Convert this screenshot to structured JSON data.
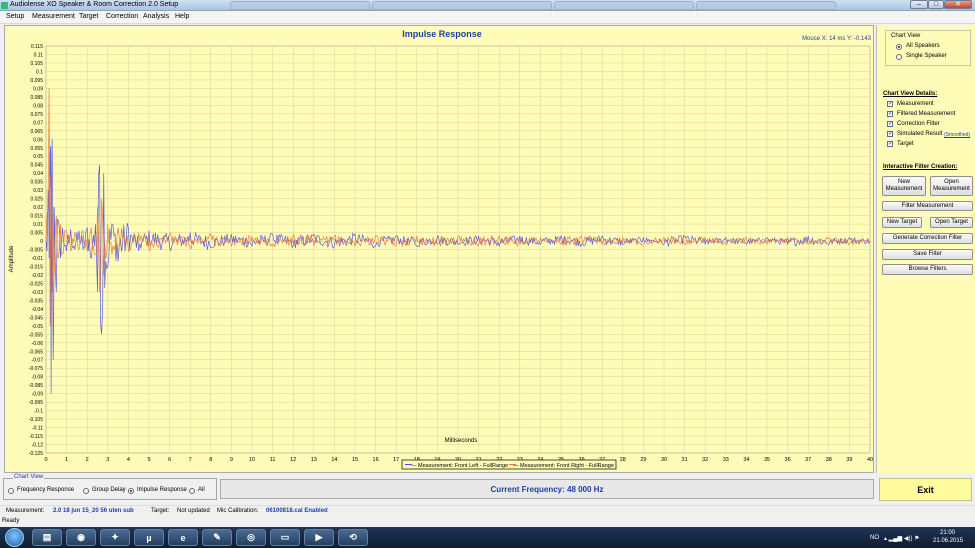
{
  "window": {
    "title": "Audiolense XO Speaker & Room Correction 2.0 Setup",
    "min_label": "–",
    "max_label": "□",
    "close_label": "✕"
  },
  "menu": [
    "Setup",
    "Measurement",
    "Target",
    "Correction",
    "Analysis",
    "Help"
  ],
  "chart": {
    "title": "Impulse Response",
    "mouse_readout": "Mouse X: 14 ms   Y: -0.143",
    "ylabel": "Amplitude",
    "xlabel": "Milliseconds",
    "legend": [
      "— Measurement: Front Left - FullRange",
      "— Measurement: Front Right - FullRange"
    ],
    "colors": {
      "left": "#4a4ae6",
      "right": "#e8703a",
      "grid": "#d8d29a",
      "axis": "#000000",
      "title": "#1f3fa5",
      "background": "#fffcb8"
    }
  },
  "chart_data": {
    "type": "line",
    "title": "Impulse Response",
    "xlabel": "Milliseconds",
    "ylabel": "Amplitude",
    "xlim": [
      0,
      40
    ],
    "ylim": [
      -0.125,
      0.115
    ],
    "x_ticks": [
      "0",
      "1",
      "2",
      "3",
      "4",
      "5",
      "6",
      "7",
      "8",
      "9",
      "10",
      "11",
      "12",
      "13",
      "14",
      "15",
      "16",
      "17",
      "18",
      "19",
      "20",
      "21",
      "22",
      "23",
      "24",
      "25",
      "26",
      "27",
      "28",
      "29",
      "30",
      "31",
      "32",
      "33",
      "34",
      "35",
      "36",
      "37",
      "38",
      "39",
      "40"
    ],
    "y_ticks": [
      "0.115",
      "0.11",
      "0.105",
      "0.1",
      "0.095",
      "0.09",
      "0.085",
      "0.08",
      "0.075",
      "0.07",
      "0.065",
      "0.06",
      "0.055",
      "0.05",
      "0.045",
      "0.04",
      "0.035",
      "0.03",
      "0.025",
      "0.02",
      "0.015",
      "0.01",
      "0.005",
      "0",
      "-0.005",
      "-0.01",
      "-0.015",
      "-0.02",
      "-0.025",
      "-0.03",
      "-0.035",
      "-0.04",
      "-0.045",
      "-0.05",
      "-0.055",
      "-0.06",
      "-0.065",
      "-0.07",
      "-0.075",
      "-0.08",
      "-0.085",
      "-0.09",
      "-0.095",
      "-0.1",
      "-0.105",
      "-0.11",
      "-0.115",
      "-0.12",
      "-0.125"
    ],
    "grid": true,
    "legend_position": "bottom-center",
    "series": [
      {
        "name": "Measurement: Front Left - FullRange",
        "x": [
          0,
          0.1,
          0.15,
          0.2,
          0.25,
          0.3,
          0.35,
          0.4,
          0.5,
          0.6,
          0.7,
          0.8,
          1.0,
          1.2,
          1.4,
          1.6,
          1.8,
          2.0,
          2.2,
          2.4,
          2.5,
          2.6,
          2.7,
          2.8,
          3.0,
          3.2,
          3.5,
          4.0,
          4.5,
          5.0,
          6,
          7,
          8,
          9,
          10,
          11,
          12,
          13,
          14,
          15,
          16,
          17,
          18,
          19,
          20,
          21,
          22,
          23,
          24,
          25,
          26,
          27,
          28,
          29,
          30,
          31,
          32,
          33,
          34,
          35,
          36,
          37,
          38,
          39,
          40
        ],
        "y": [
          0,
          0.03,
          -0.01,
          0.05,
          -0.09,
          0.06,
          -0.07,
          0.02,
          -0.03,
          0.012,
          -0.01,
          0.008,
          -0.006,
          0.007,
          -0.005,
          0.006,
          -0.005,
          0.008,
          -0.01,
          0.01,
          -0.03,
          0.045,
          -0.055,
          0.04,
          -0.015,
          0.01,
          -0.012,
          0.008,
          -0.006,
          0.006,
          -0.004,
          0.005,
          -0.004,
          0.004,
          -0.003,
          0.004,
          -0.003,
          0.004,
          -0.003,
          0.004,
          -0.003,
          0.003,
          -0.003,
          0.003,
          -0.002,
          0.003,
          -0.003,
          0.003,
          -0.002,
          0.003,
          -0.002,
          0.003,
          -0.002,
          0.002,
          -0.002,
          0.003,
          -0.002,
          0.002,
          -0.002,
          0.002,
          -0.002,
          0.003,
          -0.002,
          0.002,
          0
        ]
      },
      {
        "name": "Measurement: Front Right - FullRange",
        "x": [
          0,
          0.1,
          0.15,
          0.2,
          0.25,
          0.3,
          0.35,
          0.4,
          0.5,
          0.6,
          0.7,
          0.8,
          1.0,
          1.2,
          1.4,
          1.6,
          1.8,
          2.0,
          2.2,
          2.4,
          2.5,
          2.6,
          2.7,
          2.8,
          3.0,
          3.2,
          3.5,
          4.0,
          4.5,
          5.0,
          6,
          7,
          8,
          9,
          10,
          11,
          12,
          13,
          14,
          15,
          16,
          17,
          18,
          19,
          20,
          21,
          22,
          23,
          24,
          25,
          26,
          27,
          28,
          29,
          30,
          31,
          32,
          33,
          34,
          35,
          36,
          37,
          38,
          39,
          40
        ],
        "y": [
          0,
          0.02,
          0.09,
          -0.05,
          0.04,
          -0.03,
          0.02,
          -0.02,
          0.015,
          -0.01,
          0.01,
          -0.007,
          0.006,
          -0.006,
          0.005,
          -0.005,
          0.006,
          -0.006,
          0.008,
          -0.008,
          0.02,
          -0.03,
          0.025,
          -0.02,
          0.01,
          -0.008,
          0.008,
          -0.006,
          0.005,
          -0.005,
          0.004,
          -0.004,
          0.004,
          -0.003,
          0.003,
          -0.003,
          0.004,
          -0.003,
          0.003,
          -0.003,
          0.003,
          -0.003,
          0.003,
          -0.002,
          0.003,
          -0.002,
          0.003,
          -0.002,
          0.002,
          -0.002,
          0.003,
          -0.002,
          0.002,
          -0.002,
          0.002,
          -0.002,
          0.002,
          -0.002,
          0.002,
          -0.002,
          0.002,
          -0.002,
          0.002,
          -0.002,
          0
        ]
      }
    ]
  },
  "right_panel": {
    "chart_view_group": "Chart View",
    "radio_all": "All Speakers",
    "radio_single": "Single Speaker",
    "details_header": "Chart View Details:",
    "checks": [
      "Measurement",
      "Filtered Measurement",
      "Correction Filter",
      "Simulated Result",
      "Target"
    ],
    "smoothed_link": "(Smoothed)",
    "filter_header": "Interactive Filter Creation:",
    "btn_new_measurement": "New Measurement",
    "btn_open_measurement": "Open Measurement",
    "btn_filter_measurement": "Filter Measurement",
    "btn_new_target": "New Target",
    "btn_open_target": "Open Target",
    "btn_generate": "Generate Correction Filter",
    "btn_save": "Save Filter",
    "btn_browse": "Browse Filters"
  },
  "bottom": {
    "chart_view_label": "Chart View",
    "options": [
      "Frequency Response",
      "Group Delay",
      "Impulse Response",
      "All"
    ],
    "selected": "Impulse Response",
    "current_frequency": "Current Frequency: 48 000 Hz",
    "exit": "Exit"
  },
  "status": {
    "measurement_label": "Measurement:",
    "measurement_value": "2.0 18 jun 15_20 56 uten sub",
    "target_label": "Target:",
    "target_value": "Not updated",
    "mic_label": "Mic Calibration:",
    "mic_value": "06100818.cal Enabled",
    "ready": "Ready"
  },
  "taskbar": {
    "lang": "NO",
    "time": "21:00",
    "date": "21.06.2015"
  }
}
